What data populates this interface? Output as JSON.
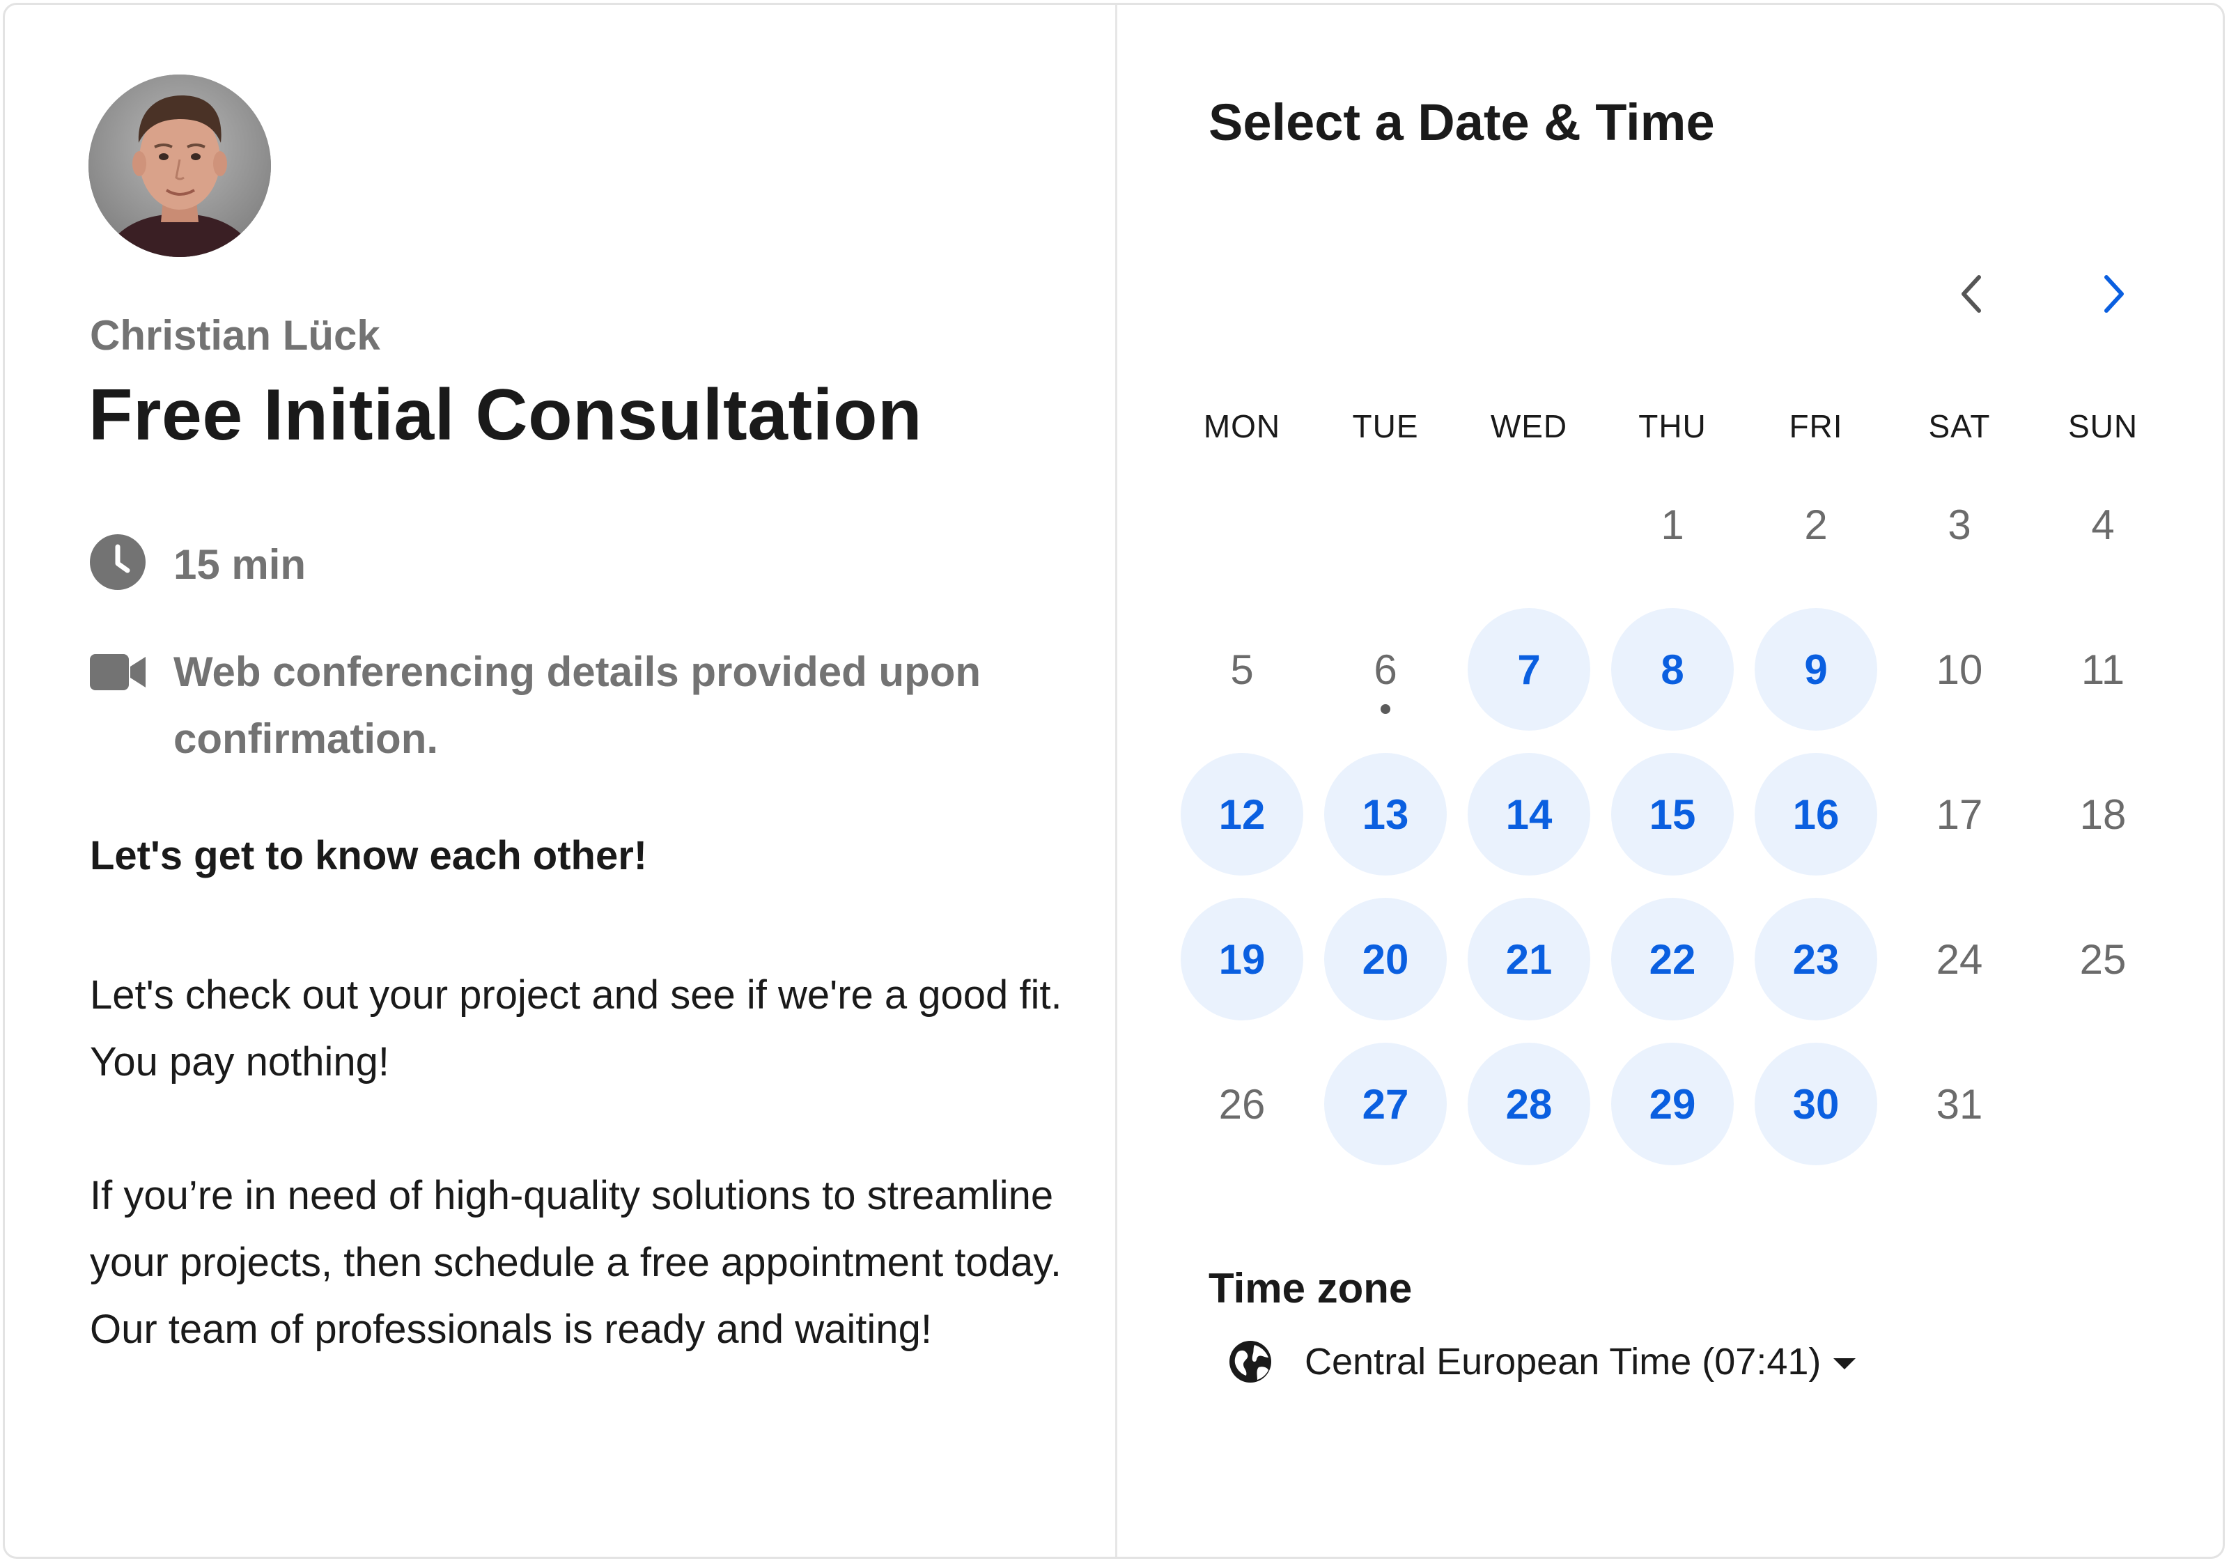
{
  "host": {
    "name": "Christian Lück"
  },
  "event": {
    "title": "Free Initial Consultation",
    "duration": "15 min",
    "location": "Web conferencing details provided upon confirmation.",
    "tagline": "Let's get to know each other!",
    "paragraph_1": "Let's check out your project and see if we're a good fit. You pay nothing!",
    "paragraph_2": "If you’re in need of high-quality solutions to streamline your projects, then schedule a free appointment today. Our team of professionals is ready and waiting!"
  },
  "calendar": {
    "title": "Select a Date & Time",
    "weekdays": [
      "MON",
      "TUE",
      "WED",
      "THU",
      "FRI",
      "SAT",
      "SUN"
    ],
    "today": 6,
    "first_weekday_index": 3,
    "days": [
      {
        "n": "1",
        "available": false
      },
      {
        "n": "2",
        "available": false
      },
      {
        "n": "3",
        "available": false
      },
      {
        "n": "4",
        "available": false
      },
      {
        "n": "5",
        "available": false
      },
      {
        "n": "6",
        "available": false
      },
      {
        "n": "7",
        "available": true
      },
      {
        "n": "8",
        "available": true
      },
      {
        "n": "9",
        "available": true
      },
      {
        "n": "10",
        "available": false
      },
      {
        "n": "11",
        "available": false
      },
      {
        "n": "12",
        "available": true
      },
      {
        "n": "13",
        "available": true
      },
      {
        "n": "14",
        "available": true
      },
      {
        "n": "15",
        "available": true
      },
      {
        "n": "16",
        "available": true
      },
      {
        "n": "17",
        "available": false
      },
      {
        "n": "18",
        "available": false
      },
      {
        "n": "19",
        "available": true
      },
      {
        "n": "20",
        "available": true
      },
      {
        "n": "21",
        "available": true
      },
      {
        "n": "22",
        "available": true
      },
      {
        "n": "23",
        "available": true
      },
      {
        "n": "24",
        "available": false
      },
      {
        "n": "25",
        "available": false
      },
      {
        "n": "26",
        "available": false
      },
      {
        "n": "27",
        "available": true
      },
      {
        "n": "28",
        "available": true
      },
      {
        "n": "29",
        "available": true
      },
      {
        "n": "30",
        "available": true
      },
      {
        "n": "31",
        "available": false
      }
    ],
    "prev_icon": "chevron-left-icon",
    "next_icon": "chevron-right-icon"
  },
  "timezone": {
    "label": "Time zone",
    "value": "Central European Time (07:41)",
    "icon": "globe-icon"
  },
  "colors": {
    "accent": "#0a5fe0",
    "available_bg": "#eaf2fd",
    "muted_text": "#737373"
  }
}
